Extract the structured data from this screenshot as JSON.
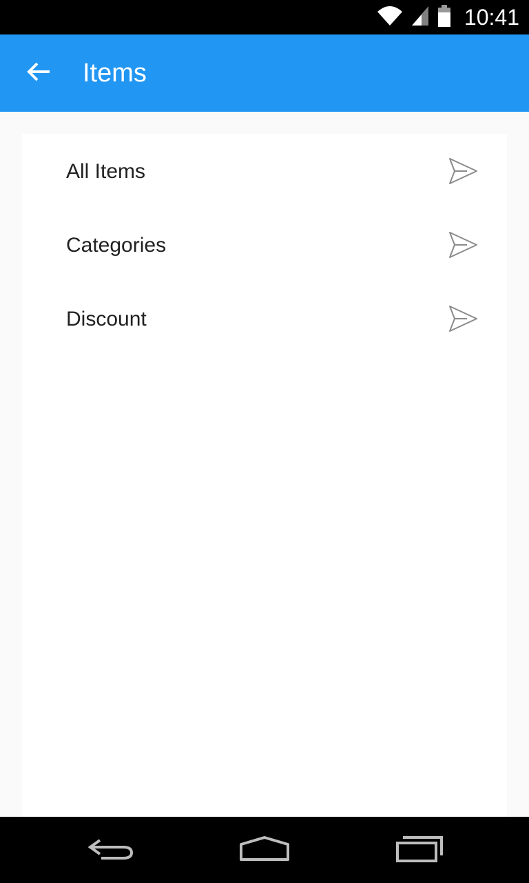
{
  "status_bar": {
    "time": "10:41",
    "icons": [
      "wifi-icon",
      "signal-icon",
      "battery-icon"
    ]
  },
  "app_bar": {
    "title": "Items",
    "back_icon": "arrow-back-icon",
    "color": "#2196f3"
  },
  "menu": {
    "items": [
      {
        "label": "All Items",
        "icon": "send-icon"
      },
      {
        "label": "Categories",
        "icon": "send-icon"
      },
      {
        "label": "Discount",
        "icon": "send-icon"
      }
    ]
  },
  "nav_bar": {
    "buttons": [
      "back-nav-icon",
      "home-nav-icon",
      "recents-nav-icon"
    ]
  }
}
